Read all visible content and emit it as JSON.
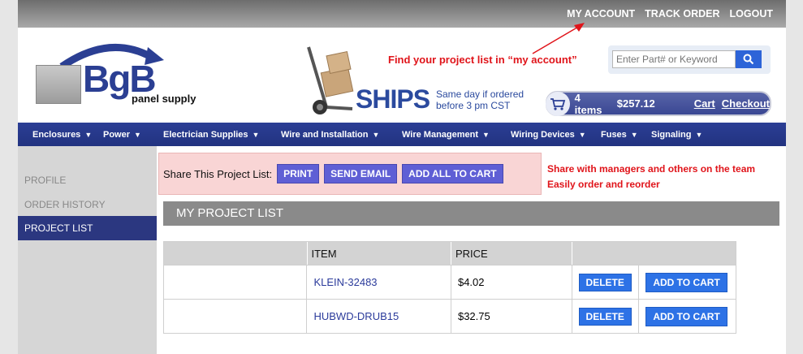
{
  "top_links": [
    "MY ACCOUNT",
    "TRACK ORDER",
    "LOGOUT"
  ],
  "logo": {
    "brand": "BgB",
    "sub": "panel supply"
  },
  "annotation_account": "Find your project list in “my account”",
  "ships": {
    "title": "SHIPS",
    "sub": "Same day if ordered before 3 pm CST"
  },
  "search": {
    "placeholder": "Enter Part# or Keyword"
  },
  "cart": {
    "count": "4 items",
    "total": "$257.12",
    "cart_label": "Cart",
    "checkout_label": "Checkout"
  },
  "nav": [
    "Enclosures",
    "Power",
    "Electrician Supplies",
    "Wire and Installation",
    "Wire Management",
    "Wiring Devices",
    "Fuses",
    "Signaling"
  ],
  "sidebar": [
    "PROFILE",
    "ORDER HISTORY",
    "PROJECT LIST"
  ],
  "share": {
    "label": "Share This Project List:",
    "buttons": [
      "PRINT",
      "SEND EMAIL",
      "ADD ALL TO CART"
    ]
  },
  "annotation_team": [
    "Share with managers and others on the team",
    "Easily order and reorder"
  ],
  "section_title": "MY PROJECT LIST",
  "table": {
    "headers": [
      "",
      "ITEM",
      "PRICE",
      ""
    ],
    "rows": [
      {
        "item": "KLEIN-32483",
        "price": "$4.02",
        "delete": "DELETE",
        "add": "ADD TO CART"
      },
      {
        "item": "HUBWD-DRUB15",
        "price": "$32.75",
        "delete": "DELETE",
        "add": "ADD TO CART"
      }
    ]
  },
  "colors": {
    "brand_blue": "#2b3e95",
    "annotation_red": "#e0141a",
    "button_blue": "#2d72e6",
    "share_purple": "#5f5fd5"
  }
}
